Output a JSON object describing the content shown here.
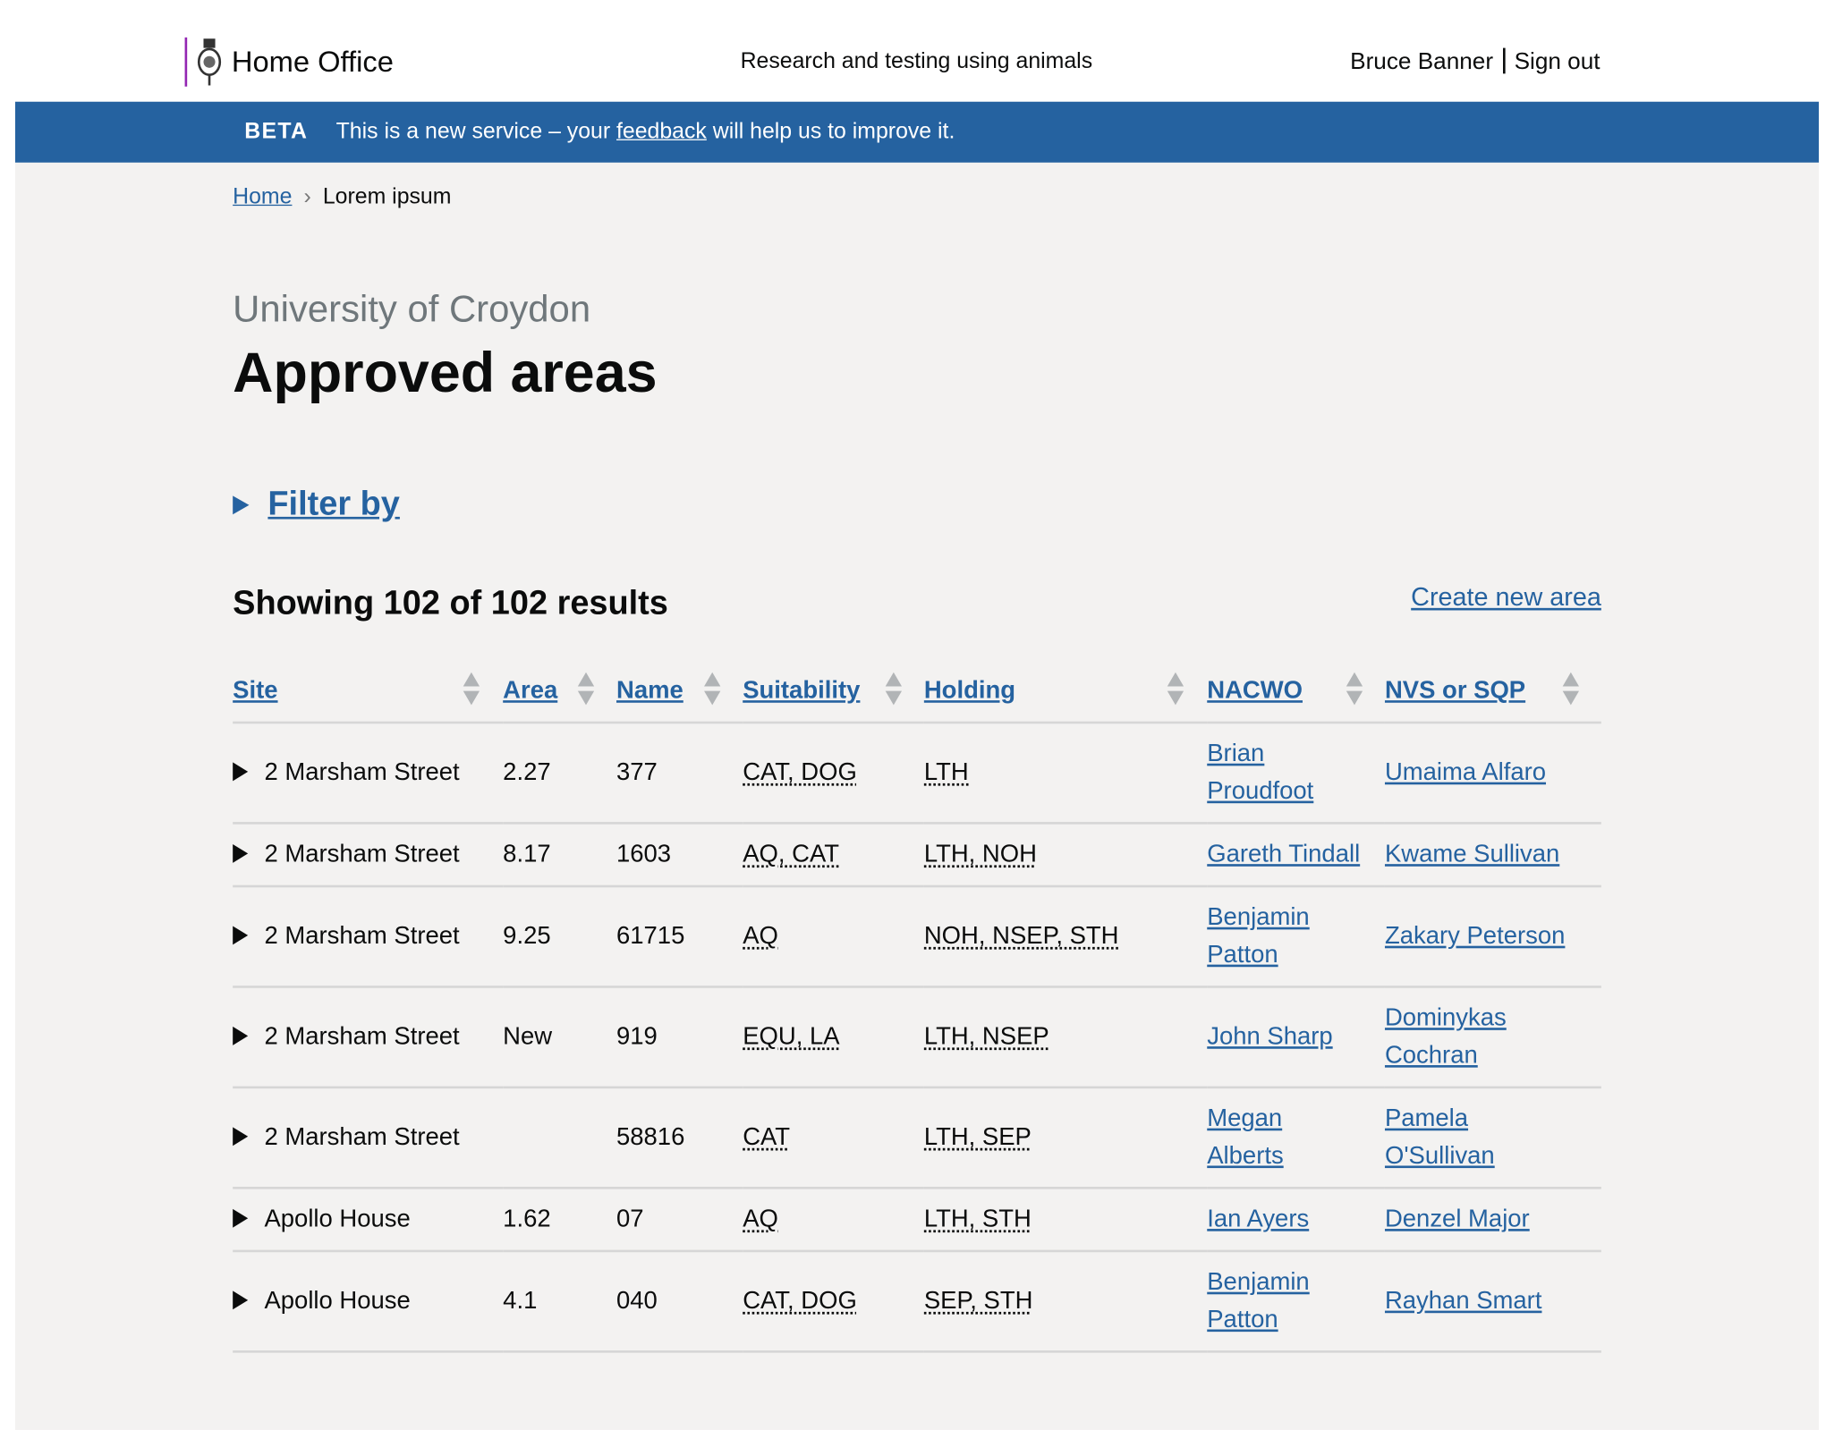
{
  "header": {
    "org": "Home Office",
    "service": "Research and testing using animals",
    "user": "Bruce Banner",
    "sign_out": "Sign out"
  },
  "beta": {
    "tag": "BETA",
    "text_before": "This is a new service – your",
    "link": "feedback",
    "text_after": "will help us to improve it."
  },
  "breadcrumb": {
    "home": "Home",
    "current": "Lorem ipsum"
  },
  "caption": "University of Croydon",
  "title": "Approved areas",
  "filter_label": "Filter by",
  "results_text": "Showing 102 of 102 results",
  "create_link": "Create new area",
  "columns": [
    "Site",
    "Area",
    "Name",
    "Suitability",
    "Holding",
    "NACWO",
    "NVS or SQP"
  ],
  "rows": [
    {
      "site": "2 Marsham Street",
      "area": "2.27",
      "name": "377",
      "suitability": "CAT, DOG",
      "holding": "LTH",
      "nacwo": "Brian Proudfoot",
      "nvs": "Umaima Alfaro"
    },
    {
      "site": "2 Marsham Street",
      "area": "8.17",
      "name": "1603",
      "suitability": "AQ, CAT",
      "holding": "LTH, NOH",
      "nacwo": "Gareth Tindall",
      "nvs": "Kwame Sullivan"
    },
    {
      "site": "2 Marsham Street",
      "area": "9.25",
      "name": "61715",
      "suitability": "AQ",
      "holding": "NOH, NSEP, STH",
      "nacwo": "Benjamin Patton",
      "nvs": "Zakary Peterson"
    },
    {
      "site": "2 Marsham Street",
      "area": "New",
      "name": "919",
      "suitability": "EQU, LA",
      "holding": "LTH, NSEP",
      "nacwo": "John Sharp",
      "nvs": "Dominykas Cochran"
    },
    {
      "site": "2 Marsham Street",
      "area": "",
      "name": "58816",
      "suitability": "CAT",
      "holding": "LTH, SEP",
      "nacwo": "Megan Alberts",
      "nvs": "Pamela O'Sullivan"
    },
    {
      "site": "Apollo House",
      "area": "1.62",
      "name": "07",
      "suitability": "AQ",
      "holding": "LTH, STH",
      "nacwo": "Ian Ayers",
      "nvs": "Denzel Major"
    },
    {
      "site": "Apollo House",
      "area": "4.1",
      "name": "040",
      "suitability": "CAT, DOG",
      "holding": "SEP, STH",
      "nacwo": "Benjamin Patton",
      "nvs": "Rayhan Smart"
    }
  ]
}
